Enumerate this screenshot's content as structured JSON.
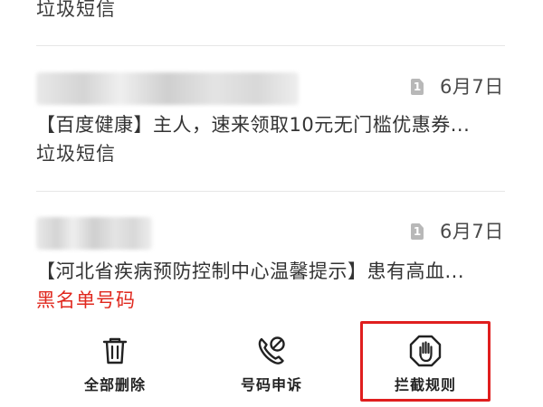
{
  "messages": [
    {
      "category": "垃圾短信"
    },
    {
      "sim": "1",
      "date": "6月7日",
      "preview": "【百度健康】主人，速来领取10元无门槛优惠券...",
      "category": "垃圾短信"
    },
    {
      "sim": "1",
      "date": "6月7日",
      "preview": "【河北省疾病预防控制中心温馨提示】患有高血...",
      "category": "黑名单号码"
    }
  ],
  "actions": {
    "delete_all": "全部删除",
    "number_appeal": "号码申诉",
    "block_rules": "拦截规则"
  },
  "colors": {
    "spam_tag": "#3a3a3a",
    "blacklist_tag": "#e0281e",
    "highlight_box": "#e01e1e"
  },
  "icons": {
    "delete_all": "trash-icon",
    "number_appeal": "phone-block-icon",
    "block_rules": "hand-stop-icon"
  }
}
